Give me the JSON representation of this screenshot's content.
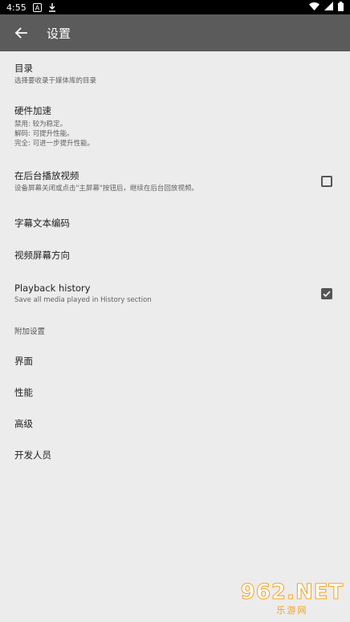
{
  "status_bar": {
    "time": "4:55",
    "left_icons": [
      "notification-a-icon",
      "download-icon"
    ],
    "right_icons": [
      "wifi-icon",
      "signal-icon",
      "battery-icon"
    ]
  },
  "toolbar": {
    "back_icon": "arrow-back-icon",
    "title": "设置"
  },
  "preferences": [
    {
      "title": "目录",
      "summary": "选择要收录于媒体库的目录"
    },
    {
      "title": "硬件加速",
      "summary_lines": [
        "禁用: 较为稳定。",
        "解码: 可提升性能。",
        "完全: 可进一步提升性能。"
      ]
    },
    {
      "title": "在后台播放视频",
      "summary": "设备屏幕关闭或点击\"主屏幕\"按钮后，继续在后台回放视频。",
      "checked": false
    },
    {
      "title": "字幕文本编码"
    },
    {
      "title": "视频屏幕方向"
    },
    {
      "title": "Playback history",
      "summary": "Save all media played in History section",
      "checked": true
    }
  ],
  "category": {
    "title": "附加设置"
  },
  "extra_items": [
    {
      "title": "界面"
    },
    {
      "title": "性能"
    },
    {
      "title": "高级"
    },
    {
      "title": "开发人员"
    }
  ],
  "watermark": {
    "main": "962.NET",
    "sub": "乐游网"
  },
  "colors": {
    "toolbar": "#5b5b5b",
    "background": "#ececec",
    "status_bar": "#000000",
    "checkbox": "#555555",
    "watermark": "#f6a21b"
  }
}
